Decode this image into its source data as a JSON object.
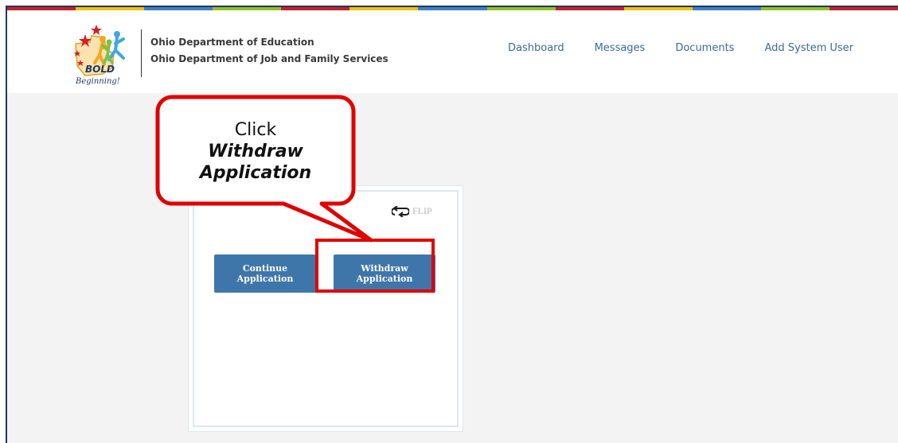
{
  "header": {
    "logo": {
      "icon": "bold-beginning-logo",
      "text_bold": "BOLD",
      "text_script": "Beginning!"
    },
    "org_line1": "Ohio Department of Education",
    "org_line2": "Ohio Department of Job and Family Services",
    "nav": [
      {
        "label": "Dashboard"
      },
      {
        "label": "Messages"
      },
      {
        "label": "Documents"
      },
      {
        "label": "Add System User"
      }
    ],
    "stripe_colors": [
      "#c8202a",
      "#f2c200",
      "#3f7fc4",
      "#94c11f",
      "#c8202a",
      "#f2c200",
      "#3f7fc4",
      "#94c11f",
      "#c8202a",
      "#f2c200",
      "#3f7fc4",
      "#94c11f",
      "#c8202a"
    ]
  },
  "card": {
    "flip_label": "FLIP",
    "flip_icon": "flip-arrows-icon",
    "continue_label": "Continue Application",
    "withdraw_label": "Withdraw Application"
  },
  "annotation": {
    "line1": "Click",
    "line2": "Withdraw",
    "line3": "Application",
    "color": "#e00000"
  },
  "colors": {
    "button": "#3f76a9",
    "nav_link": "#3a6a9a",
    "frame": "#1f3864",
    "content_bg": "#f3f3f3"
  }
}
